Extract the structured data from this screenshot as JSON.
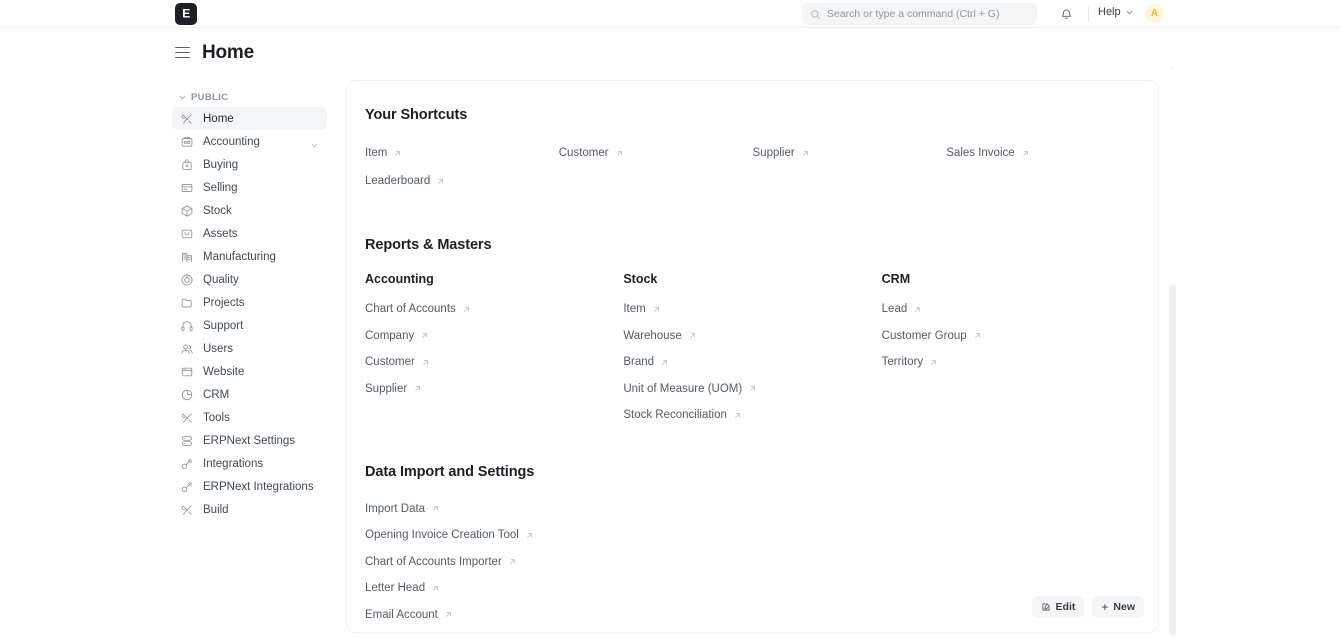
{
  "navbar": {
    "logo_letter": "E",
    "logo_name": "erpnext-logo",
    "search": {
      "placeholder": "Search or type a command (Ctrl + G)",
      "value": ""
    },
    "notifications_label": "Notifications",
    "help_label": "Help",
    "avatar_initial": "A",
    "avatar_bg": "#fdf6dd",
    "avatar_fg": "#e8b931"
  },
  "page": {
    "title": "Home"
  },
  "sidebar": {
    "section_label": "PUBLIC",
    "items": [
      {
        "label": "Home",
        "icon": "tools-icon",
        "active": true,
        "expandable": false
      },
      {
        "label": "Accounting",
        "icon": "accounting-icon",
        "active": false,
        "expandable": true
      },
      {
        "label": "Buying",
        "icon": "buying-icon",
        "active": false,
        "expandable": false
      },
      {
        "label": "Selling",
        "icon": "selling-icon",
        "active": false,
        "expandable": false
      },
      {
        "label": "Stock",
        "icon": "box-icon",
        "active": false,
        "expandable": false
      },
      {
        "label": "Assets",
        "icon": "assets-icon",
        "active": false,
        "expandable": false
      },
      {
        "label": "Manufacturing",
        "icon": "factory-icon",
        "active": false,
        "expandable": false
      },
      {
        "label": "Quality",
        "icon": "quality-icon",
        "active": false,
        "expandable": false
      },
      {
        "label": "Projects",
        "icon": "folder-icon",
        "active": false,
        "expandable": false
      },
      {
        "label": "Support",
        "icon": "headset-icon",
        "active": false,
        "expandable": false
      },
      {
        "label": "Users",
        "icon": "users-icon",
        "active": false,
        "expandable": false
      },
      {
        "label": "Website",
        "icon": "window-icon",
        "active": false,
        "expandable": false
      },
      {
        "label": "CRM",
        "icon": "pie-chart-icon",
        "active": false,
        "expandable": false
      },
      {
        "label": "Tools",
        "icon": "tools-icon",
        "active": false,
        "expandable": false
      },
      {
        "label": "ERPNext Settings",
        "icon": "settings-stack-icon",
        "active": false,
        "expandable": false
      },
      {
        "label": "Integrations",
        "icon": "plug-icon",
        "active": false,
        "expandable": false
      },
      {
        "label": "ERPNext Integrations",
        "icon": "plug-icon",
        "active": false,
        "expandable": false
      },
      {
        "label": "Build",
        "icon": "tools-icon",
        "active": false,
        "expandable": false
      }
    ]
  },
  "main": {
    "shortcuts": {
      "title": "Your Shortcuts",
      "items": [
        {
          "label": "Item"
        },
        {
          "label": "Customer"
        },
        {
          "label": "Supplier"
        },
        {
          "label": "Sales Invoice"
        },
        {
          "label": "Leaderboard"
        }
      ]
    },
    "reports": {
      "title": "Reports & Masters",
      "columns": [
        {
          "title": "Accounting",
          "links": [
            {
              "label": "Chart of Accounts"
            },
            {
              "label": "Company"
            },
            {
              "label": "Customer"
            },
            {
              "label": "Supplier"
            }
          ]
        },
        {
          "title": "Stock",
          "links": [
            {
              "label": "Item"
            },
            {
              "label": "Warehouse"
            },
            {
              "label": "Brand"
            },
            {
              "label": "Unit of Measure (UOM)"
            },
            {
              "label": "Stock Reconciliation"
            }
          ]
        },
        {
          "title": "CRM",
          "links": [
            {
              "label": "Lead"
            },
            {
              "label": "Customer Group"
            },
            {
              "label": "Territory"
            }
          ]
        }
      ]
    },
    "data_import": {
      "title": "Data Import and Settings",
      "links": [
        {
          "label": "Import Data"
        },
        {
          "label": "Opening Invoice Creation Tool"
        },
        {
          "label": "Chart of Accounts Importer"
        },
        {
          "label": "Letter Head"
        },
        {
          "label": "Email Account"
        }
      ]
    },
    "actions": {
      "edit_label": "Edit",
      "new_label": "New",
      "new_prefix": "+"
    }
  }
}
